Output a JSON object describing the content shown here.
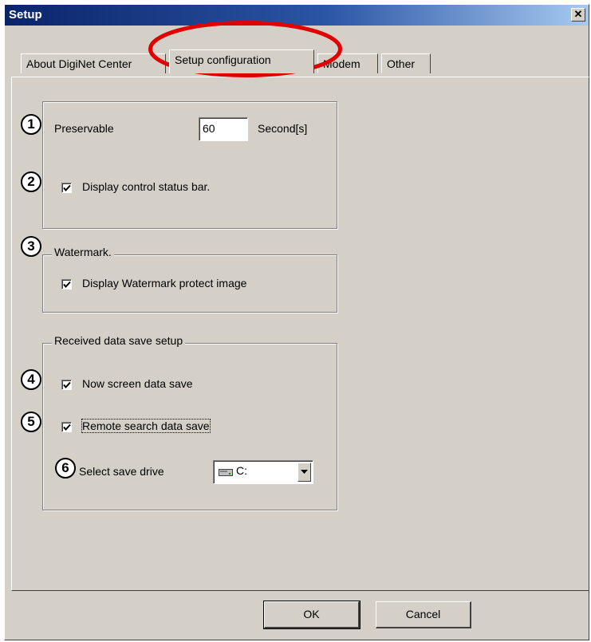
{
  "window": {
    "title": "Setup",
    "close_glyph": "✕"
  },
  "tabs": [
    {
      "label": "About DigiNet Center"
    },
    {
      "label": "Setup configuration"
    },
    {
      "label": "Modem"
    },
    {
      "label": "Other"
    }
  ],
  "markers": [
    "1",
    "2",
    "3",
    "4",
    "5",
    "6"
  ],
  "general": {
    "preservable_label": "Preservable",
    "preservable_value": "60",
    "unit_label": "Second[s]",
    "status_bar_label": "Display control status bar.",
    "status_bar_checked": true
  },
  "watermark": {
    "title": "Watermark.",
    "protect_label": "Display Watermark protect image",
    "protect_checked": true
  },
  "received": {
    "title": "Received data save setup",
    "now_screen_label": "Now screen data save",
    "remote_search_label": "Remote search data save",
    "drive_label": "Select save drive",
    "drive_value": "C:"
  },
  "buttons": {
    "ok": "OK",
    "cancel": "Cancel"
  },
  "colors": {
    "title_bar": "#0a246a",
    "face": "#d4d0c8",
    "highlight_ellipse": "#e00000"
  },
  "icons": {
    "drive": "drive-icon",
    "combo_arrow": "chevron-down-icon",
    "check": "check-icon"
  }
}
